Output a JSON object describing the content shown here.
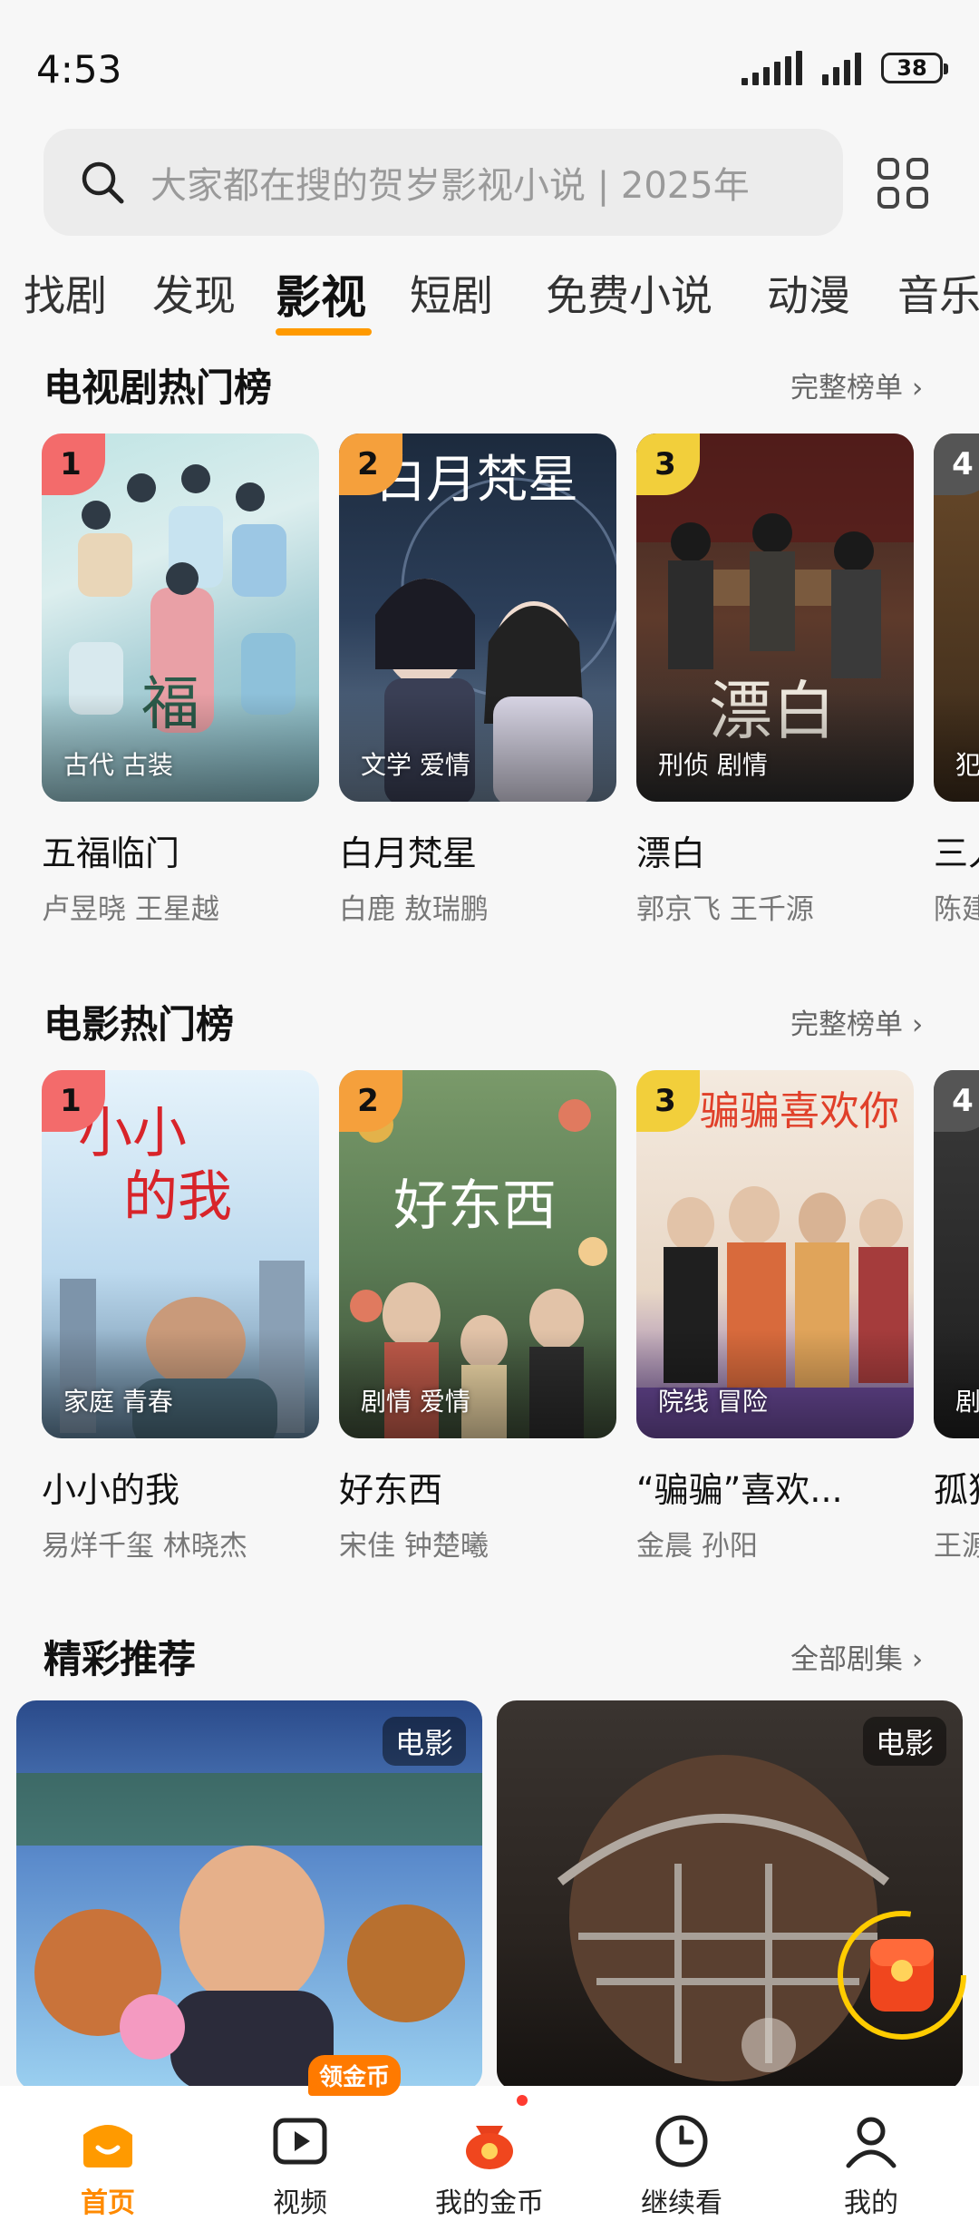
{
  "status": {
    "time": "4:53",
    "battery": "38"
  },
  "search": {
    "placeholder": "大家都在搜的贺岁影视小说 | 2025年"
  },
  "tabs": [
    {
      "label": "找剧"
    },
    {
      "label": "发现"
    },
    {
      "label": "影视"
    },
    {
      "label": "短剧"
    },
    {
      "label": "免费小说"
    },
    {
      "label": "动漫"
    },
    {
      "label": "音乐"
    }
  ],
  "active_tab": "影视",
  "tv_section": {
    "title": "电视剧热门榜",
    "more": "完整榜单",
    "items": [
      {
        "rank": "1",
        "title": "五福临门",
        "cast": "卢昱晓 王星越",
        "tags": "古代 古装",
        "rank_color": "#f36b6b"
      },
      {
        "rank": "2",
        "title": "白月梵星",
        "cast": "白鹿 敖瑞鹏",
        "tags": "文学 爱情",
        "rank_color": "#f5a03c"
      },
      {
        "rank": "3",
        "title": "漂白",
        "cast": "郭京飞 王千源",
        "tags": "刑侦 剧情",
        "rank_color": "#f2cf3b"
      },
      {
        "rank": "4",
        "title": "三人",
        "cast": "陈建",
        "tags": "犯罪",
        "rank_color": "#555555"
      }
    ]
  },
  "movie_section": {
    "title": "电影热门榜",
    "more": "完整榜单",
    "items": [
      {
        "rank": "1",
        "title": "小小的我",
        "cast": "易烊千玺 林晓杰",
        "tags": "家庭 青春",
        "rank_color": "#f36b6b"
      },
      {
        "rank": "2",
        "title": "好东西",
        "cast": "宋佳 钟楚曦",
        "tags": "剧情 爱情",
        "rank_color": "#f5a03c"
      },
      {
        "rank": "3",
        "title": "“骗骗”喜欢...",
        "cast": "金晨 孙阳",
        "tags": "院线 冒险",
        "rank_color": "#f2cf3b"
      },
      {
        "rank": "4",
        "title": "孤独",
        "cast": "王源",
        "tags": "剧",
        "rank_color": "#555555"
      }
    ]
  },
  "rec_section": {
    "title": "精彩推荐",
    "more": "全部剧集",
    "items": [
      {
        "badge": "电影"
      },
      {
        "badge": "电影"
      }
    ]
  },
  "bottom_nav": {
    "items": [
      {
        "label": "首页",
        "icon": "home-icon"
      },
      {
        "label": "视频",
        "icon": "video-icon"
      },
      {
        "label": "我的金币",
        "icon": "coin-bag-icon"
      },
      {
        "label": "继续看",
        "icon": "clock-icon"
      },
      {
        "label": "我的",
        "icon": "person-icon"
      }
    ],
    "badge": "领金币"
  },
  "colors": {
    "accent": "#ff8a00",
    "rank1": "#f36b6b",
    "rank2": "#f5a03c",
    "rank3": "#f2cf3b"
  }
}
